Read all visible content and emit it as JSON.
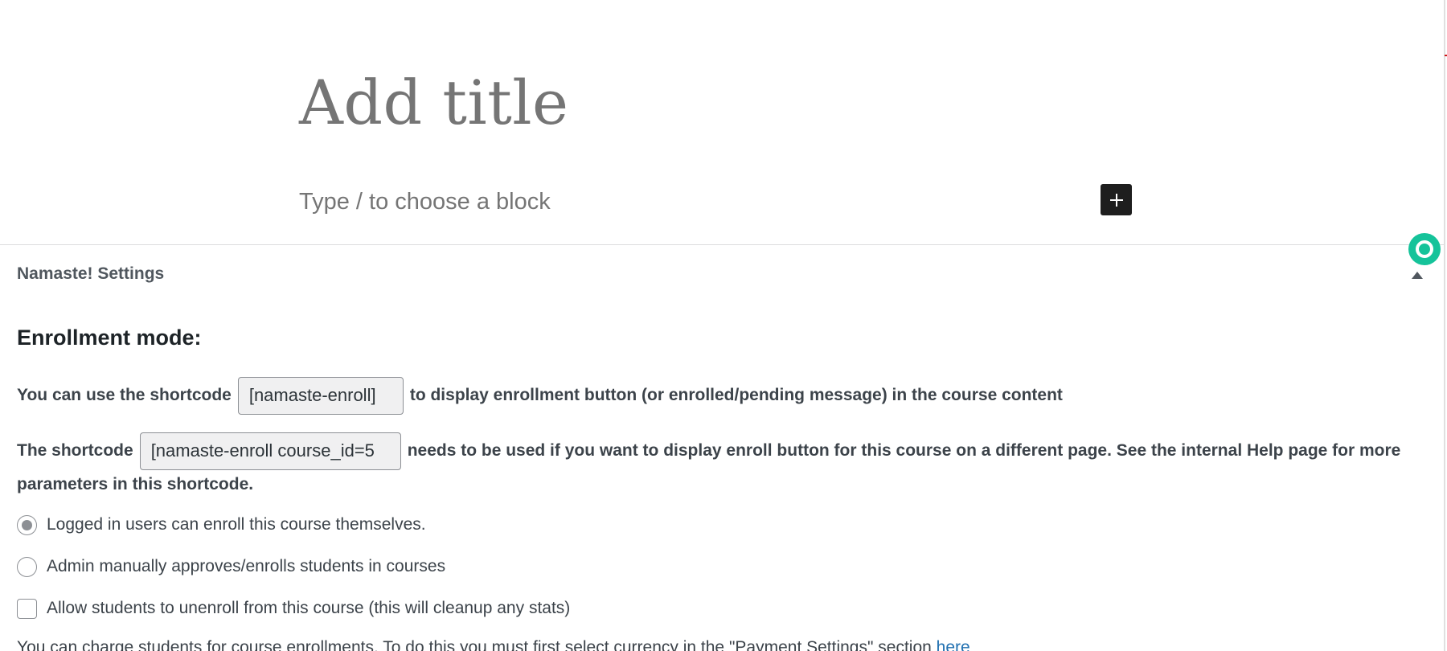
{
  "editor": {
    "title_placeholder": "Add title",
    "block_placeholder": "Type / to choose a block",
    "inserter_icon": "plus-icon",
    "assistant_icon": "grammarly-icon",
    "assistant_color": "#15c39a"
  },
  "metabox": {
    "title": "Namaste! Settings",
    "toggle_icon": "triangle-up-icon",
    "section_heading": "Enrollment mode:",
    "shortcode_line": {
      "before": "You can use the shortcode",
      "shortcode": "[namaste-enroll]",
      "after": "to display enrollment button (or enrolled/pending message) in the course content"
    },
    "course_shortcode_line": {
      "before": "The shortcode",
      "shortcode": "[namaste-enroll course_id=5",
      "after": "needs to be used if you want to display enroll button for this course on a different page. See the internal Help page for more",
      "continued": "parameters in this shortcode."
    },
    "options": [
      {
        "label": "Logged in users can enroll this course themselves.",
        "type": "radio",
        "checked": true
      },
      {
        "label": "Admin manually approves/enrolls students in courses",
        "type": "radio",
        "checked": false
      },
      {
        "label": "Allow students to unenroll from this course (this will cleanup any stats)",
        "type": "checkbox",
        "checked": false
      }
    ],
    "payment_note": {
      "text": "You can charge students for course enrollments. To do this you must first select currency in the \"Payment Settings\" section ",
      "link": "here"
    },
    "link_color": "#2271b1"
  }
}
